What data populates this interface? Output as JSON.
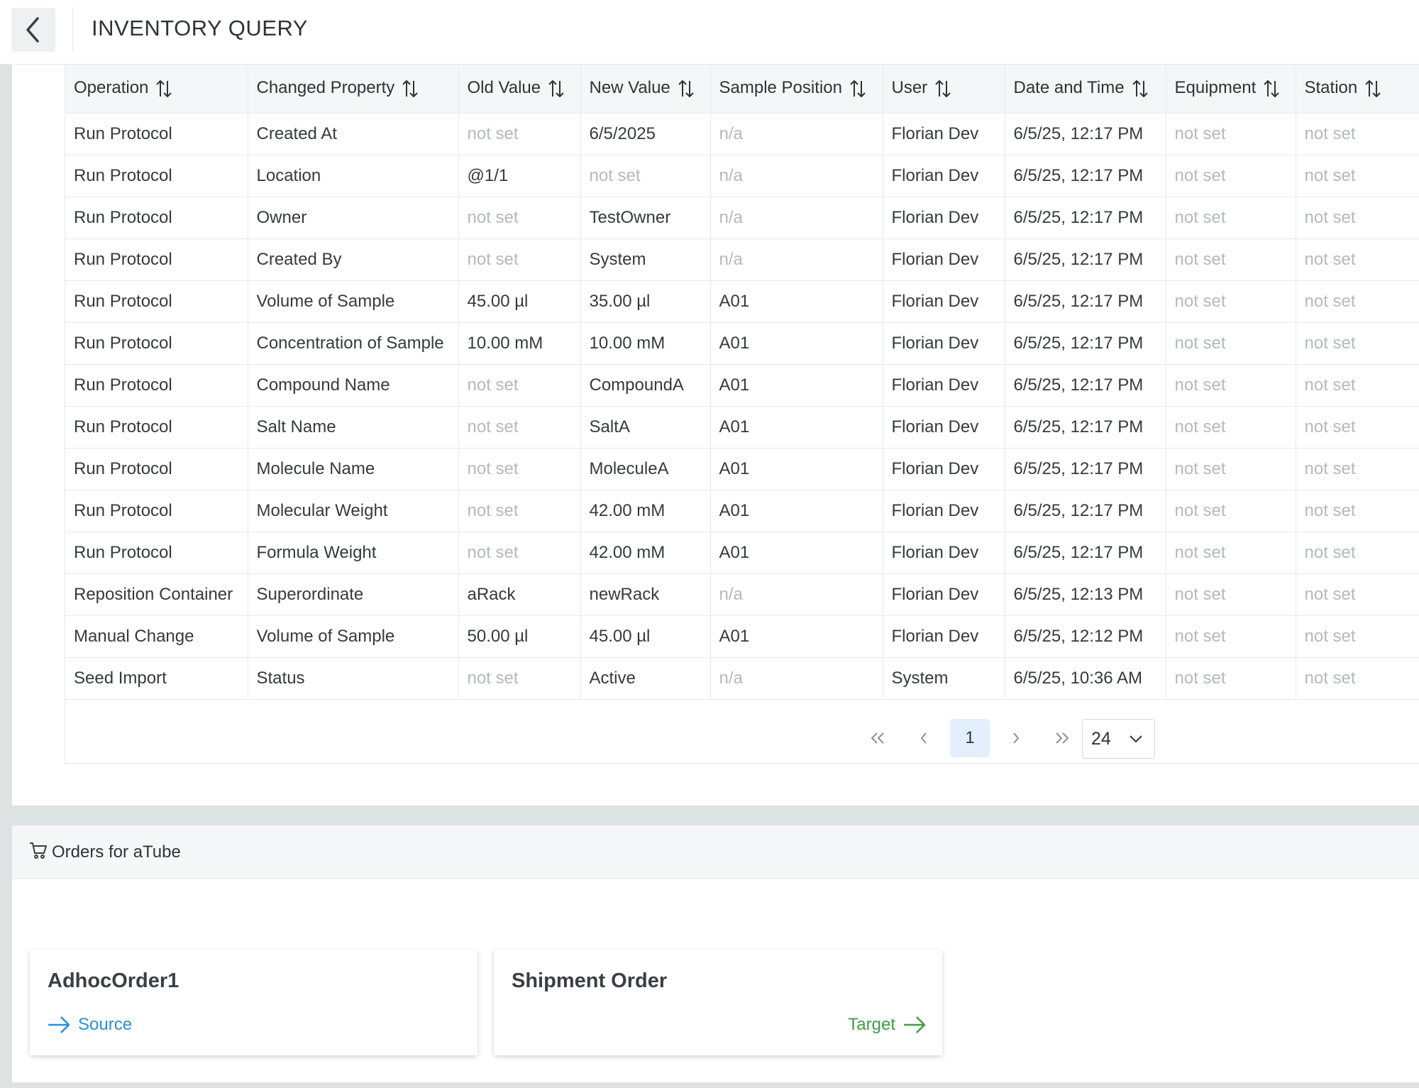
{
  "header": {
    "title": "INVENTORY QUERY"
  },
  "history": {
    "columns": [
      "Operation",
      "Changed Property",
      "Old Value",
      "New Value",
      "Sample Position",
      "User",
      "Date and Time",
      "Equipment",
      "Station"
    ],
    "rows": [
      [
        "Run Protocol",
        "Created At",
        "not set",
        "6/5/2025",
        "n/a",
        "Florian Dev",
        "6/5/25, 12:17 PM",
        "not set",
        "not set"
      ],
      [
        "Run Protocol",
        "Location",
        "@1/1",
        "not set",
        "n/a",
        "Florian Dev",
        "6/5/25, 12:17 PM",
        "not set",
        "not set"
      ],
      [
        "Run Protocol",
        "Owner",
        "not set",
        "TestOwner",
        "n/a",
        "Florian Dev",
        "6/5/25, 12:17 PM",
        "not set",
        "not set"
      ],
      [
        "Run Protocol",
        "Created By",
        "not set",
        "System",
        "n/a",
        "Florian Dev",
        "6/5/25, 12:17 PM",
        "not set",
        "not set"
      ],
      [
        "Run Protocol",
        "Volume of Sample",
        "45.00 µl",
        "35.00 µl",
        "A01",
        "Florian Dev",
        "6/5/25, 12:17 PM",
        "not set",
        "not set"
      ],
      [
        "Run Protocol",
        "Concentration of Sample",
        "10.00 mM",
        "10.00 mM",
        "A01",
        "Florian Dev",
        "6/5/25, 12:17 PM",
        "not set",
        "not set"
      ],
      [
        "Run Protocol",
        "Compound Name",
        "not set",
        "CompoundA",
        "A01",
        "Florian Dev",
        "6/5/25, 12:17 PM",
        "not set",
        "not set"
      ],
      [
        "Run Protocol",
        "Salt Name",
        "not set",
        "SaltA",
        "A01",
        "Florian Dev",
        "6/5/25, 12:17 PM",
        "not set",
        "not set"
      ],
      [
        "Run Protocol",
        "Molecule Name",
        "not set",
        "MoleculeA",
        "A01",
        "Florian Dev",
        "6/5/25, 12:17 PM",
        "not set",
        "not set"
      ],
      [
        "Run Protocol",
        "Molecular Weight",
        "not set",
        "42.00 mM",
        "A01",
        "Florian Dev",
        "6/5/25, 12:17 PM",
        "not set",
        "not set"
      ],
      [
        "Run Protocol",
        "Formula Weight",
        "not set",
        "42.00 mM",
        "A01",
        "Florian Dev",
        "6/5/25, 12:17 PM",
        "not set",
        "not set"
      ],
      [
        "Reposition Container",
        "Superordinate",
        "aRack",
        "newRack",
        "n/a",
        "Florian Dev",
        "6/5/25, 12:13 PM",
        "not set",
        "not set"
      ],
      [
        "Manual Change",
        "Volume of Sample",
        "50.00 µl",
        "45.00 µl",
        "A01",
        "Florian Dev",
        "6/5/25, 12:12 PM",
        "not set",
        "not set"
      ],
      [
        "Seed Import",
        "Status",
        "not set",
        "Active",
        "n/a",
        "System",
        "6/5/25, 10:36 AM",
        "not set",
        "not set"
      ]
    ]
  },
  "pagination": {
    "current_page": "1",
    "page_size": "24"
  },
  "orders": {
    "title": "Orders for aTube",
    "cards": [
      {
        "name": "AdhocOrder1",
        "role": "Source"
      },
      {
        "name": "Shipment Order",
        "role": "Target"
      }
    ]
  },
  "colors": {
    "source": "#2b8fd6",
    "target": "#3d9e47",
    "muted": "#b4b9bd"
  },
  "icons": [
    "back-icon",
    "sort-icon",
    "first-page-icon",
    "prev-page-icon",
    "next-page-icon",
    "last-page-icon",
    "chevron-down-icon",
    "cart-icon",
    "arrow-right-icon"
  ]
}
